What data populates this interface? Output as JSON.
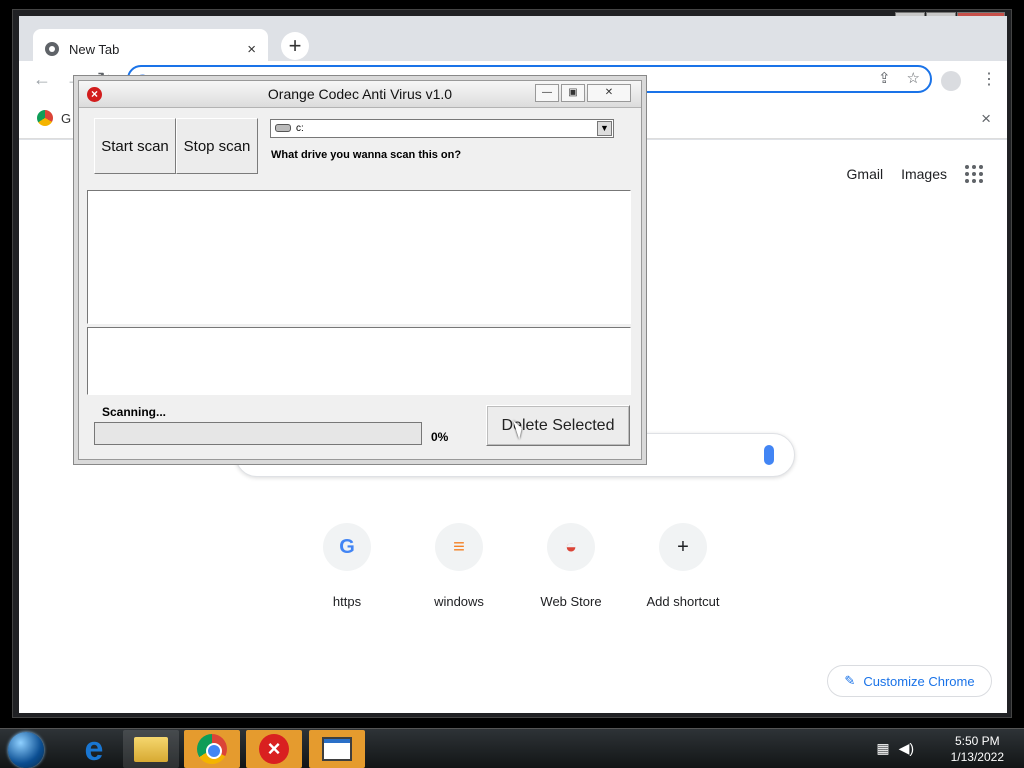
{
  "browser": {
    "tab_title": "New Tab",
    "omnibox_value": "",
    "bookmark_label": "G",
    "top_links": [
      "Gmail",
      "Images"
    ],
    "shortcuts": [
      {
        "label": "https",
        "icon": "google-g-icon"
      },
      {
        "label": "windows",
        "icon": "stackoverflow-icon"
      },
      {
        "label": "Web Store",
        "icon": "chrome-web-store-icon"
      },
      {
        "label": "Add shortcut",
        "icon": "plus-icon"
      }
    ],
    "customize_label": "Customize Chrome"
  },
  "dialog": {
    "title": "Orange Codec Anti Virus v1.0",
    "start_scan": "Start scan",
    "stop_scan": "Stop scan",
    "drive": "c:",
    "question": "What drive you wanna scan this on?",
    "status": "Scanning...",
    "progress_percent": "0%",
    "progress_value": 0,
    "delete_selected": "Delete Selected"
  },
  "taskbar": {
    "time": "5:50 PM",
    "date": "1/13/2022"
  },
  "colors": {
    "chrome_blue": "#1a73e8",
    "taskbar_orange": "#e59b2e",
    "red": "#d92020"
  }
}
